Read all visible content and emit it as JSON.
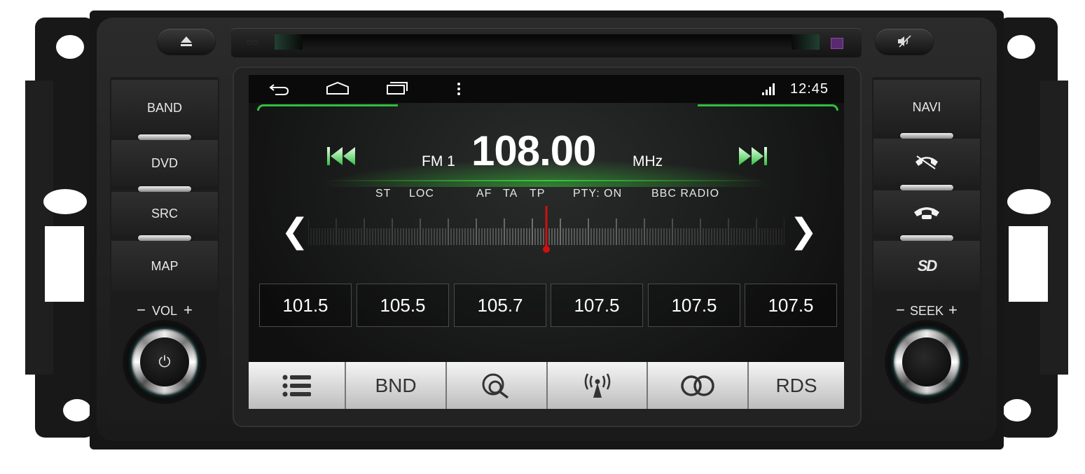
{
  "chassis": {
    "eject_icon": "eject-icon",
    "mute_icon": "mute-icon"
  },
  "left_panel": {
    "buttons": [
      "BAND",
      "DVD",
      "SRC",
      "MAP"
    ],
    "vol_label": "VOL",
    "vol_minus": "−",
    "vol_plus": "+",
    "knob_icon": "power-icon",
    "knob_glyph": "⏻"
  },
  "right_panel": {
    "navi": "NAVI",
    "icons": [
      "phone-hangup-icon",
      "phone-icon",
      "sd-card-icon"
    ],
    "sd_glyph": "SD",
    "seek_label": "SEEK",
    "seek_minus": "−",
    "seek_plus": "+"
  },
  "status_bar": {
    "icons": [
      "back-icon",
      "home-icon",
      "recent-apps-icon",
      "menu-icon",
      "signal-icon"
    ],
    "time": "12:45"
  },
  "radio": {
    "band": "FM 1",
    "frequency": "108.00",
    "unit": "MHz",
    "indicators": {
      "st": "ST",
      "loc": "LOC",
      "af": "AF",
      "ta": "TA",
      "tp": "TP",
      "pty": "PTY: ON",
      "station": "BBC RADIO"
    },
    "prev_icon": "skip-previous-icon",
    "next_icon": "skip-next-icon",
    "tune_left_glyph": "❮",
    "tune_right_glyph": "❯",
    "needle_position": 0.5,
    "presets": [
      "101.5",
      "105.5",
      "105.7",
      "107.5",
      "107.5",
      "107.5"
    ]
  },
  "bottom_bar": {
    "list_icon": "list-icon",
    "bnd": "BND",
    "scan_icon": "search-scan-icon",
    "antenna_icon": "antenna-icon",
    "stereo_icon": "stereo-icon",
    "rds": "RDS"
  },
  "colors": {
    "accent_green": "#2fbf3f",
    "needle_red": "#d01010"
  }
}
